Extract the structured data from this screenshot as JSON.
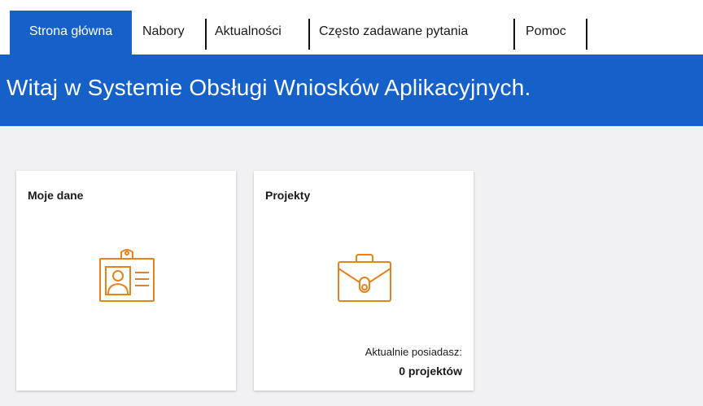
{
  "nav": {
    "items": [
      {
        "label": "Strona główna",
        "active": true
      },
      {
        "label": "Nabory",
        "active": false
      },
      {
        "label": "Aktualności",
        "active": false
      },
      {
        "label": "Często zadawane pytania",
        "active": false
      },
      {
        "label": "Pomoc",
        "active": false
      }
    ]
  },
  "banner": {
    "title": "Witaj w Systemie Obsługi Wniosków Aplikacyjnych."
  },
  "tiles": [
    {
      "title": "Moje dane",
      "icon": "id-badge-icon"
    },
    {
      "title": "Projekty",
      "icon": "briefcase-icon",
      "note": "Aktualnie posiadasz:",
      "count": "0 projektów"
    }
  ],
  "colors": {
    "brand_blue": "#1660c9",
    "icon_orange": "#e5821e",
    "content_bg": "#f1f1f3"
  }
}
